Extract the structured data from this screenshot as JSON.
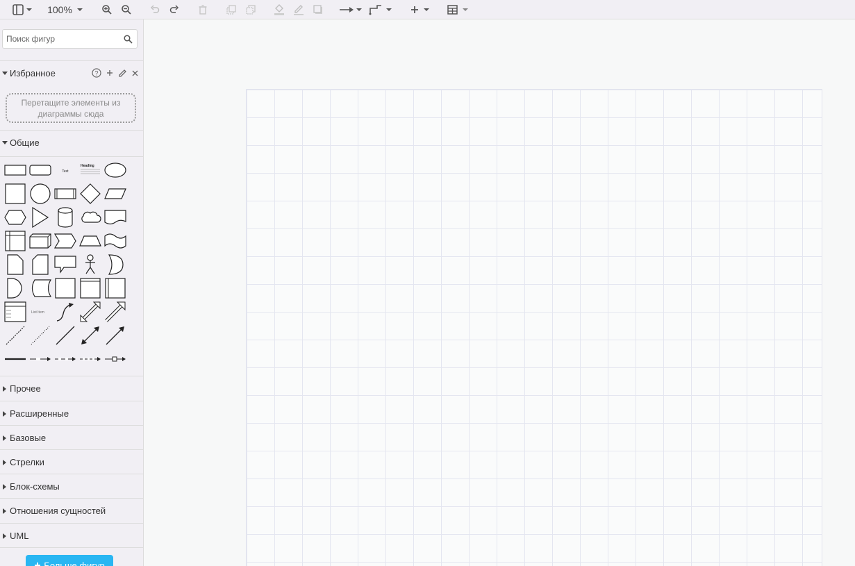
{
  "toolbar": {
    "zoom": "100%"
  },
  "search": {
    "placeholder": "Поиск фигур"
  },
  "favorites": {
    "title": "Избранное",
    "dropzone_text": "Перетащите элементы из диаграммы сюда"
  },
  "general": {
    "title": "Общие",
    "shape_labels": {
      "text": "Text",
      "heading": "Heading",
      "list_item": "List Item"
    }
  },
  "sections": [
    {
      "label": "Прочее"
    },
    {
      "label": "Расширенные"
    },
    {
      "label": "Базовые"
    },
    {
      "label": "Стрелки"
    },
    {
      "label": "Блок-схемы"
    },
    {
      "label": "Отношения сущностей"
    },
    {
      "label": "UML"
    }
  ],
  "more_button": {
    "label": "Больше фигур"
  },
  "colors": {
    "accent": "#29b6f2",
    "panel": "#f1eff4",
    "grid": "#e4e6f0"
  }
}
